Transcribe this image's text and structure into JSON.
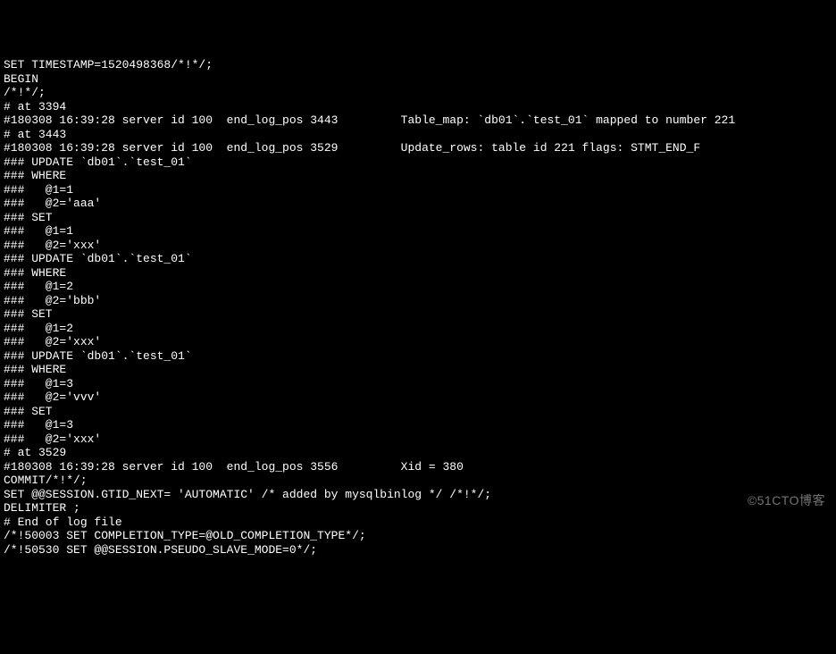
{
  "lines": [
    "SET TIMESTAMP=1520498368/*!*/;",
    "BEGIN",
    "/*!*/;",
    "# at 3394",
    "#180308 16:39:28 server id 100  end_log_pos 3443         Table_map: `db01`.`test_01` mapped to number 221",
    "# at 3443",
    "#180308 16:39:28 server id 100  end_log_pos 3529         Update_rows: table id 221 flags: STMT_END_F",
    "### UPDATE `db01`.`test_01`",
    "### WHERE",
    "###   @1=1",
    "###   @2='aaa'",
    "### SET",
    "###   @1=1",
    "###   @2='xxx'",
    "### UPDATE `db01`.`test_01`",
    "### WHERE",
    "###   @1=2",
    "###   @2='bbb'",
    "### SET",
    "###   @1=2",
    "###   @2='xxx'",
    "### UPDATE `db01`.`test_01`",
    "### WHERE",
    "###   @1=3",
    "###   @2='vvv'",
    "### SET",
    "###   @1=3",
    "###   @2='xxx'",
    "# at 3529",
    "#180308 16:39:28 server id 100  end_log_pos 3556         Xid = 380",
    "COMMIT/*!*/;",
    "SET @@SESSION.GTID_NEXT= 'AUTOMATIC' /* added by mysqlbinlog */ /*!*/;",
    "DELIMITER ;",
    "# End of log file",
    "/*!50003 SET COMPLETION_TYPE=@OLD_COMPLETION_TYPE*/;",
    "/*!50530 SET @@SESSION.PSEUDO_SLAVE_MODE=0*/;"
  ],
  "watermark": "©51CTO博客"
}
